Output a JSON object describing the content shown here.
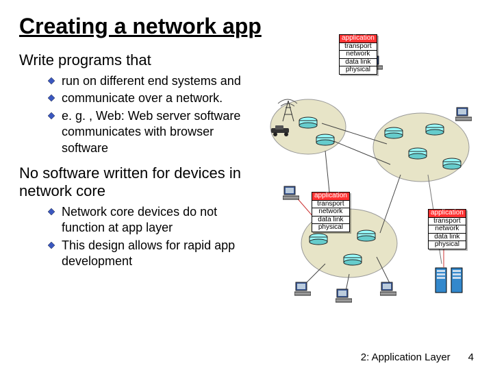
{
  "title": "Creating a network app",
  "section1": {
    "heading": "Write programs that",
    "bullets": [
      "run on different end systems and",
      "communicate over a network.",
      "e. g. , Web: Web server software communicates with browser software"
    ]
  },
  "section2": {
    "heading": "No software written for devices in network core",
    "bullets": [
      "Network core devices do not function at app layer",
      "This design allows for rapid app development"
    ]
  },
  "stack": {
    "layers": [
      "application",
      "transport",
      "network",
      "data link",
      "physical"
    ]
  },
  "footer": {
    "chapter": "2: Application Layer",
    "page": "4"
  }
}
